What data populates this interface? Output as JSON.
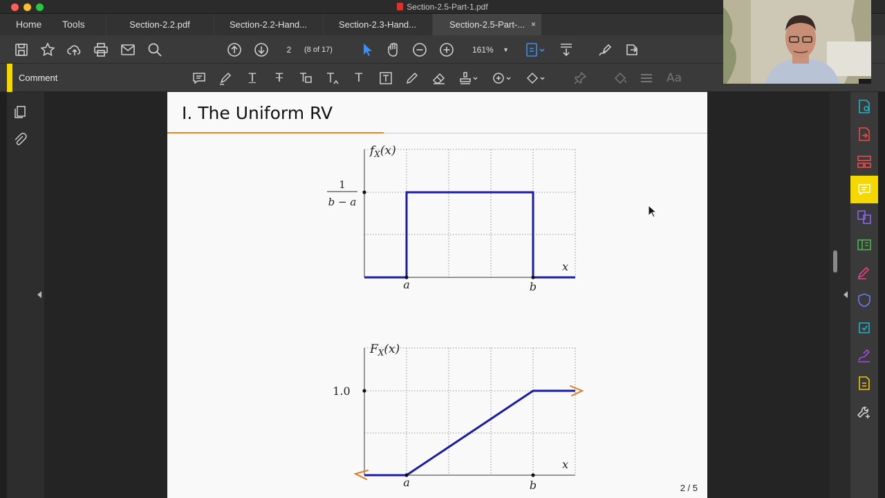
{
  "window": {
    "title": "Section-2.5-Part-1.pdf"
  },
  "nav": {
    "home": "Home",
    "tools": "Tools"
  },
  "tabs": [
    {
      "label": "Section-2.2.pdf"
    },
    {
      "label": "Section-2.2-Hand..."
    },
    {
      "label": "Section-2.3-Hand..."
    },
    {
      "label": "Section-2.5-Part-...",
      "close": "×"
    }
  ],
  "toolbar": {
    "page_value": "2",
    "page_count": "(8 of 17)",
    "zoom": "161%"
  },
  "commentbar": {
    "label": "Comment",
    "text_icon": "T",
    "font_icon": "Aa"
  },
  "page": {
    "title": "I. The Uniform RV",
    "page_number": "2 / 5",
    "pdf_chart": {
      "fx_label": "f",
      "fx_sub": "X",
      "fx_arg": "(x)",
      "fx_level_num": "1",
      "fx_level_den": "b − a",
      "x_label": "x",
      "a_label": "a",
      "b_label": "b"
    },
    "cdf_chart": {
      "Fx_label": "F",
      "Fx_sub": "X",
      "Fx_arg": "(x)",
      "level": "1.0",
      "x_label": "x",
      "a_label": "a",
      "b_label": "b"
    }
  },
  "chart_data": [
    {
      "type": "line",
      "title": "",
      "ylabel": "f_X(x)",
      "xlabel": "x",
      "x": [
        "",
        "a",
        "a",
        "b",
        "b",
        ""
      ],
      "series": [
        {
          "values": [
            0,
            0,
            1,
            1,
            0,
            0
          ]
        }
      ],
      "annotations": [
        "1/(b−a)"
      ],
      "grid": true,
      "color": "#1a1aa8"
    },
    {
      "type": "line",
      "title": "",
      "ylabel": "F_X(x)",
      "xlabel": "x",
      "x": [
        "",
        "a",
        "b",
        ""
      ],
      "series": [
        {
          "values": [
            0,
            0,
            1.0,
            1.0
          ]
        }
      ],
      "yticks": [
        "1.0"
      ],
      "grid": true,
      "color": "#1a1aa8",
      "annotation_color": "#e07a2a"
    }
  ],
  "colors": {
    "accent": "#f5d800",
    "title_rule": "#e08a1e",
    "curve": "#1a1aa8",
    "annotation": "#e07a2a"
  }
}
